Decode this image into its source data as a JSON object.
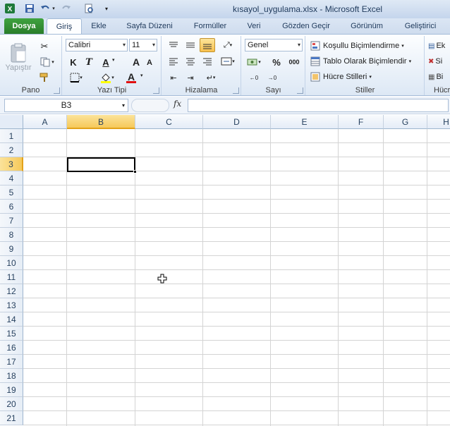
{
  "window": {
    "title": "kısayol_uygulama.xlsx  -  Microsoft Excel"
  },
  "qat": {
    "icons": [
      "excel-logo-icon",
      "save-icon",
      "undo-icon",
      "redo-icon",
      "print-preview-icon",
      "customize-qat-icon"
    ]
  },
  "tabs": [
    {
      "label": "Dosya"
    },
    {
      "label": "Giriş"
    },
    {
      "label": "Ekle"
    },
    {
      "label": "Sayfa Düzeni"
    },
    {
      "label": "Formüller"
    },
    {
      "label": "Veri"
    },
    {
      "label": "Gözden Geçir"
    },
    {
      "label": "Görünüm"
    },
    {
      "label": "Geliştirici"
    }
  ],
  "ribbon": {
    "clipboard": {
      "label": "Pano",
      "paste": "Yapıştır"
    },
    "font": {
      "label": "Yazı Tipi",
      "name": "Calibri",
      "size": "11",
      "bold": "K",
      "italic": "T",
      "underline": "A",
      "grow": "A",
      "shrink": "A",
      "fontcolor": "A"
    },
    "align": {
      "label": "Hizalama"
    },
    "number": {
      "label": "Sayı",
      "format": "Genel",
      "percent": "%",
      "thousands": "000"
    },
    "styles": {
      "label": "Stiller",
      "cond": "Koşullu Biçimlendirme",
      "table": "Tablo Olarak Biçimlendir",
      "cell": "Hücre Stilleri"
    },
    "cells": {
      "label": "Hücr",
      "insert": "Ek",
      "delete": "Si",
      "format": "Bi"
    }
  },
  "formula_bar": {
    "name_box": "B3",
    "fx": "fx",
    "value": ""
  },
  "sheet": {
    "columns": [
      "A",
      "B",
      "C",
      "D",
      "E",
      "F",
      "G",
      "H"
    ],
    "selected_column": "B",
    "rows": [
      "1",
      "2",
      "3",
      "4",
      "5",
      "6",
      "7",
      "8",
      "9",
      "10",
      "11",
      "12",
      "13",
      "14",
      "15",
      "16",
      "17",
      "18",
      "19",
      "20",
      "21"
    ],
    "selected_row": "3",
    "active_cell": "B3"
  },
  "colors": {
    "accent": "#2a7d2a",
    "selection": "#f6c95a"
  }
}
